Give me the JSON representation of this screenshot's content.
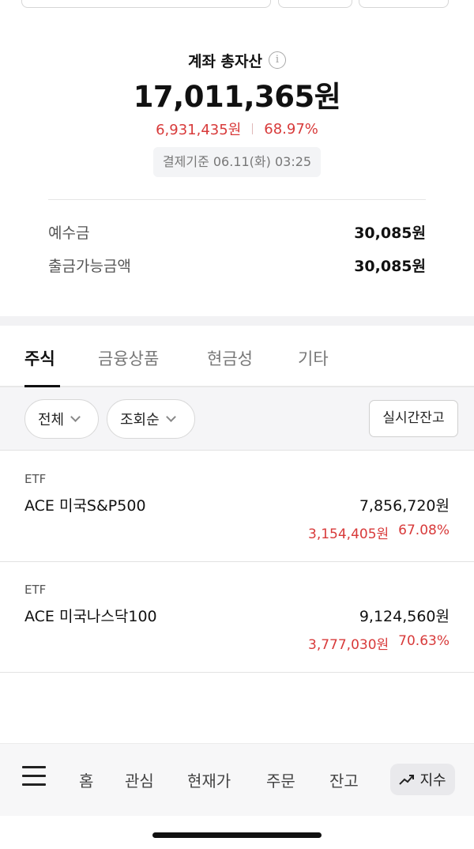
{
  "summary": {
    "label": "계좌 총자산",
    "total": "17,011,365원",
    "change_amount": "6,931,435원",
    "change_percent": "68.97%",
    "settlement": "결제기준 06.11(화) 03:25"
  },
  "balances": [
    {
      "label": "예수금",
      "value": "30,085원"
    },
    {
      "label": "출금가능금액",
      "value": "30,085원"
    }
  ],
  "tabs": [
    {
      "label": "주식",
      "active": true
    },
    {
      "label": "금융상품",
      "active": false
    },
    {
      "label": "현금성",
      "active": false
    },
    {
      "label": "기타",
      "active": false
    }
  ],
  "filters": {
    "scope": "전체",
    "sort": "조회순",
    "realtime_button": "실시간잔고"
  },
  "holdings": [
    {
      "category": "ETF",
      "name": "ACE 미국S&P500",
      "value": "7,856,720원",
      "profit": "3,154,405원",
      "rate": "67.08%"
    },
    {
      "category": "ETF",
      "name": "ACE 미국나스닥100",
      "value": "9,124,560원",
      "profit": "3,777,030원",
      "rate": "70.63%"
    }
  ],
  "bottom_nav": {
    "items": [
      "홈",
      "관심",
      "현재가",
      "주문",
      "잔고"
    ],
    "index_label": "지수",
    "menu_icon": "hamburger-icon",
    "index_icon": "trend-up-icon"
  },
  "colors": {
    "up": "#d83a3a",
    "text": "#111111",
    "muted": "#777777"
  }
}
